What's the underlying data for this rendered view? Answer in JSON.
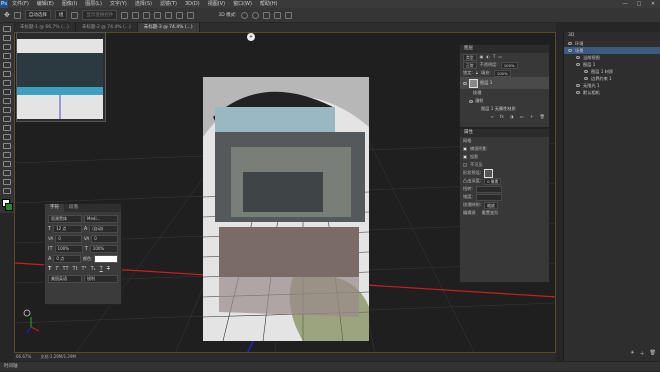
{
  "menubar": {
    "logo": "Ps",
    "items": [
      "文件(F)",
      "编辑(E)",
      "图像(I)",
      "图层(L)",
      "文字(Y)",
      "选择(S)",
      "滤镜(T)",
      "3D(D)",
      "视图(V)",
      "窗口(W)",
      "帮助(H)"
    ],
    "window_controls": [
      "—",
      "□",
      "✕"
    ]
  },
  "options": {
    "auto_select_label": "自动选择",
    "group_label": "组",
    "transform_label": "显示变换控件",
    "mode_label": "3D 模式:"
  },
  "tabs": [
    {
      "label": "未标题-1 @ 66.7% (...)",
      "active": false
    },
    {
      "label": "未标题-2 @ 74.4% (...)",
      "active": false
    },
    {
      "label": "未标题-3 @ 74.4% (...)",
      "active": true
    }
  ],
  "status": {
    "zoom": "66.67%",
    "doc": "文档:1.29M/1.29M"
  },
  "timeline": {
    "label": "时间轴"
  },
  "char_panel": {
    "tabs": [
      "字符",
      "段落"
    ],
    "font": "思源黑体",
    "style": "Medi...",
    "size": "12 点",
    "leading": "(自动)",
    "kern": "0",
    "tracking": "0",
    "vscale": "100%",
    "hscale": "100%",
    "baseline": "0 点",
    "color_label": "颜色:",
    "lang": "美国英语",
    "aa": "锐利"
  },
  "layers_panel": {
    "title": "图层",
    "kind_label": "类型",
    "blend": "正常",
    "opacity_label": "不透明度:",
    "opacity": "100%",
    "lock_label": "锁定:",
    "fill_label": "填充:",
    "fill": "100%",
    "layers": [
      {
        "name": "图层 1",
        "selected": true
      },
      {
        "name": "纹理",
        "selected": false
      },
      {
        "name": "漫射",
        "selected": false
      },
      {
        "name": "图层 1 无属性材质",
        "selected": false
      }
    ]
  },
  "props_panel": {
    "title": "属性",
    "tab": "网格",
    "shadow_label": "捕捉阴影",
    "cast_label": "投影",
    "invisible_label": "不可见",
    "shape_preset": "形状预设:",
    "depth_label": "凸出深度:",
    "depth": "0 像素",
    "twist_label": "扭转:",
    "taper_label": "锥度:",
    "texture_label": "纹理映射:",
    "texture": "缩放",
    "edit_source": "编辑源",
    "reset": "重置变形"
  },
  "scene_panel": {
    "title": "3D",
    "items": [
      {
        "name": "环境",
        "selected": false
      },
      {
        "name": "场景",
        "selected": true
      },
      {
        "name": "当前视图",
        "selected": false
      },
      {
        "name": "图层 1",
        "selected": false
      },
      {
        "name": "图层 1 材质",
        "selected": false
      },
      {
        "name": "边界约束 1",
        "selected": false
      },
      {
        "name": "无限光 1",
        "selected": false
      },
      {
        "name": "默认相机",
        "selected": false
      }
    ]
  },
  "colors": {
    "accent_border": "#5a4a2a",
    "axis_red": "#cc1f1f",
    "axis_blue": "#2222cc",
    "axis_green": "#2faa2f"
  }
}
